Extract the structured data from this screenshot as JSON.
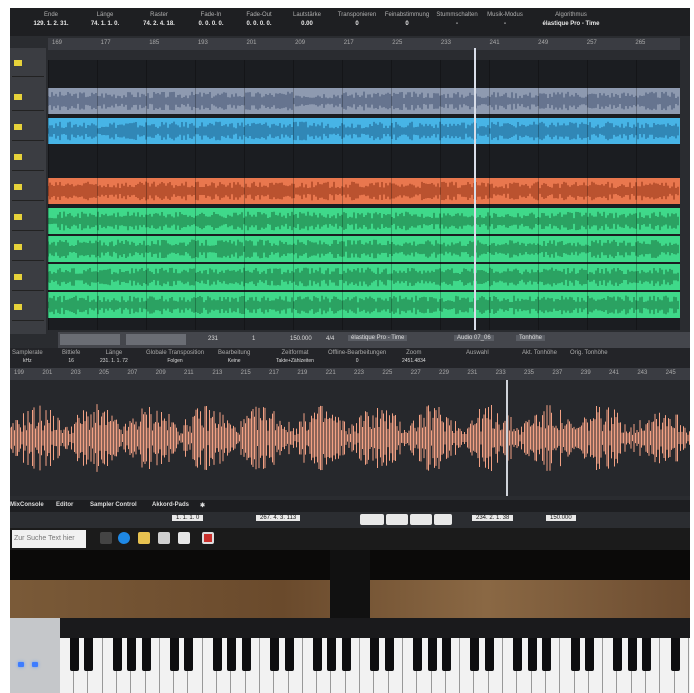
{
  "info_bar": {
    "columns": [
      {
        "label": "Ende",
        "value": "129. 1. 2. 31."
      },
      {
        "label": "Länge",
        "value": "74. 1. 1. 0."
      },
      {
        "label": "Raster",
        "value": "74. 2. 4. 18."
      },
      {
        "label": "Fade-In",
        "value": "0. 0. 0. 0."
      },
      {
        "label": "Fade-Out",
        "value": "0. 0. 0. 0."
      },
      {
        "label": "Lautstärke",
        "value": "0.00"
      },
      {
        "label": "Transponieren",
        "value": "0"
      },
      {
        "label": "Feinabstimmung",
        "value": "0"
      },
      {
        "label": "Stummschalten",
        "value": "-"
      },
      {
        "label": "Musik-Modus",
        "value": "-"
      },
      {
        "label": "Algorithmus",
        "value": "élastique Pro - Time"
      }
    ]
  },
  "project_ruler": [
    "169",
    "177",
    "185",
    "193",
    "201",
    "209",
    "217",
    "225",
    "233",
    "241",
    "249",
    "257",
    "265"
  ],
  "tracks": [
    {
      "color": "#8e9ab0",
      "wave": "#3f4f6e"
    },
    {
      "color": "#47b4e6",
      "wave": "#1b5a86"
    },
    {
      "color": "#1b1d21",
      "wave": "#1b1d21"
    },
    {
      "color": "#e9774e",
      "wave": "#8a2c10"
    },
    {
      "color": "#3fd98a",
      "wave": "#176c3a"
    },
    {
      "color": "#3fd98a",
      "wave": "#176c3a"
    },
    {
      "color": "#3fd98a",
      "wave": "#176c3a"
    },
    {
      "color": "#3fd98a",
      "wave": "#176c3a"
    }
  ],
  "lower_toolbar": {
    "grid_value": "231",
    "nudge_value": "1",
    "tempo": "150.000",
    "signature": "4/4",
    "algorithm": "élastique Pro - Time",
    "audio_file": "Audio 07_06",
    "pitch_label": "Tonhöhe"
  },
  "editor_info": {
    "columns": [
      {
        "label": "Samplerate",
        "value": "kHz"
      },
      {
        "label": "Bittiefe",
        "value": "16"
      },
      {
        "label": "Länge",
        "value": "231. 1. 1. 72"
      },
      {
        "label": "Globale Transposition",
        "value": "Folgen"
      },
      {
        "label": "Bearbeitung",
        "value": "Keine"
      },
      {
        "label": "Zeitformat",
        "value": "Takte+Zählzeiten"
      },
      {
        "label": "Offline-Bearbeitungen",
        "value": "0"
      },
      {
        "label": "Zoom",
        "value": "2451.4834"
      },
      {
        "label": "Auswahl",
        "value": ""
      },
      {
        "label": "Akt. Tonhöhe",
        "value": ""
      },
      {
        "label": "Orig. Tonhöhe",
        "value": ""
      }
    ]
  },
  "editor_ruler": [
    "199",
    "201",
    "203",
    "205",
    "207",
    "209",
    "211",
    "213",
    "215",
    "217",
    "219",
    "221",
    "223",
    "225",
    "227",
    "229",
    "231",
    "233",
    "235",
    "237",
    "239",
    "241",
    "243",
    "245"
  ],
  "editor_wave_color": "#f2a184",
  "bottom_tabs": [
    "MixConsole",
    "Editor",
    "Sampler Control",
    "Akkord-Pads"
  ],
  "transport": {
    "left_locator": "1. 1. 1. 0",
    "right_locator": "267. 4. 3. 113",
    "position": "234. 2. 1. 38",
    "tempo": "150.000"
  },
  "taskbar": {
    "search_text": "Zur Suche Text hier eingeben"
  }
}
